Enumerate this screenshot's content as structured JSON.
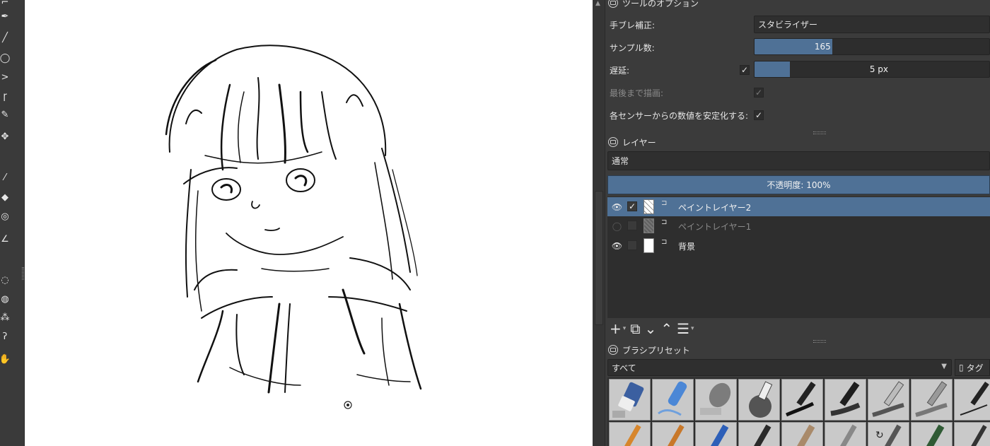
{
  "tool_options": {
    "title": "ツールのオプション",
    "smoothing_label": "手ブレ補正:",
    "smoothing_value": "スタビライザー",
    "sample_label": "サンプル数:",
    "sample_value": "165",
    "sample_fraction": 0.33,
    "delay_label": "遅延:",
    "delay_checked": "✓",
    "delay_value": "5 px",
    "delay_fraction": 0.15,
    "finish_label": "最後まで描画:",
    "finish_checked": "✓",
    "stabilize_label": "各センサーからの数値を安定化する:",
    "stabilize_checked": "✓"
  },
  "layers": {
    "title": "レイヤー",
    "blend_mode": "通常",
    "opacity_text": "不透明度: 100%",
    "items": [
      {
        "name": "ペイントレイヤー2",
        "visible": true,
        "checked": "✓",
        "active": true
      },
      {
        "name": "ペイントレイヤー1",
        "visible": false,
        "checked": "",
        "active": false
      },
      {
        "name": "背景",
        "visible": true,
        "checked": "",
        "active": false
      }
    ]
  },
  "brush_presets": {
    "title": "ブラシプリセット",
    "filter": "すべて",
    "tag_label": "タグ"
  },
  "icons": {
    "eye": "eye-icon",
    "lock": "lock-icon",
    "add": "plus-icon",
    "duplicate": "duplicate-icon",
    "move_down": "chevron-down-icon",
    "move_up": "chevron-up-icon",
    "properties": "sliders-icon",
    "tag": "bookmark-icon"
  },
  "colors": {
    "accent": "#4f7196",
    "panel_bg": "#3b3b3b",
    "canvas_bg": "#ffffff"
  }
}
